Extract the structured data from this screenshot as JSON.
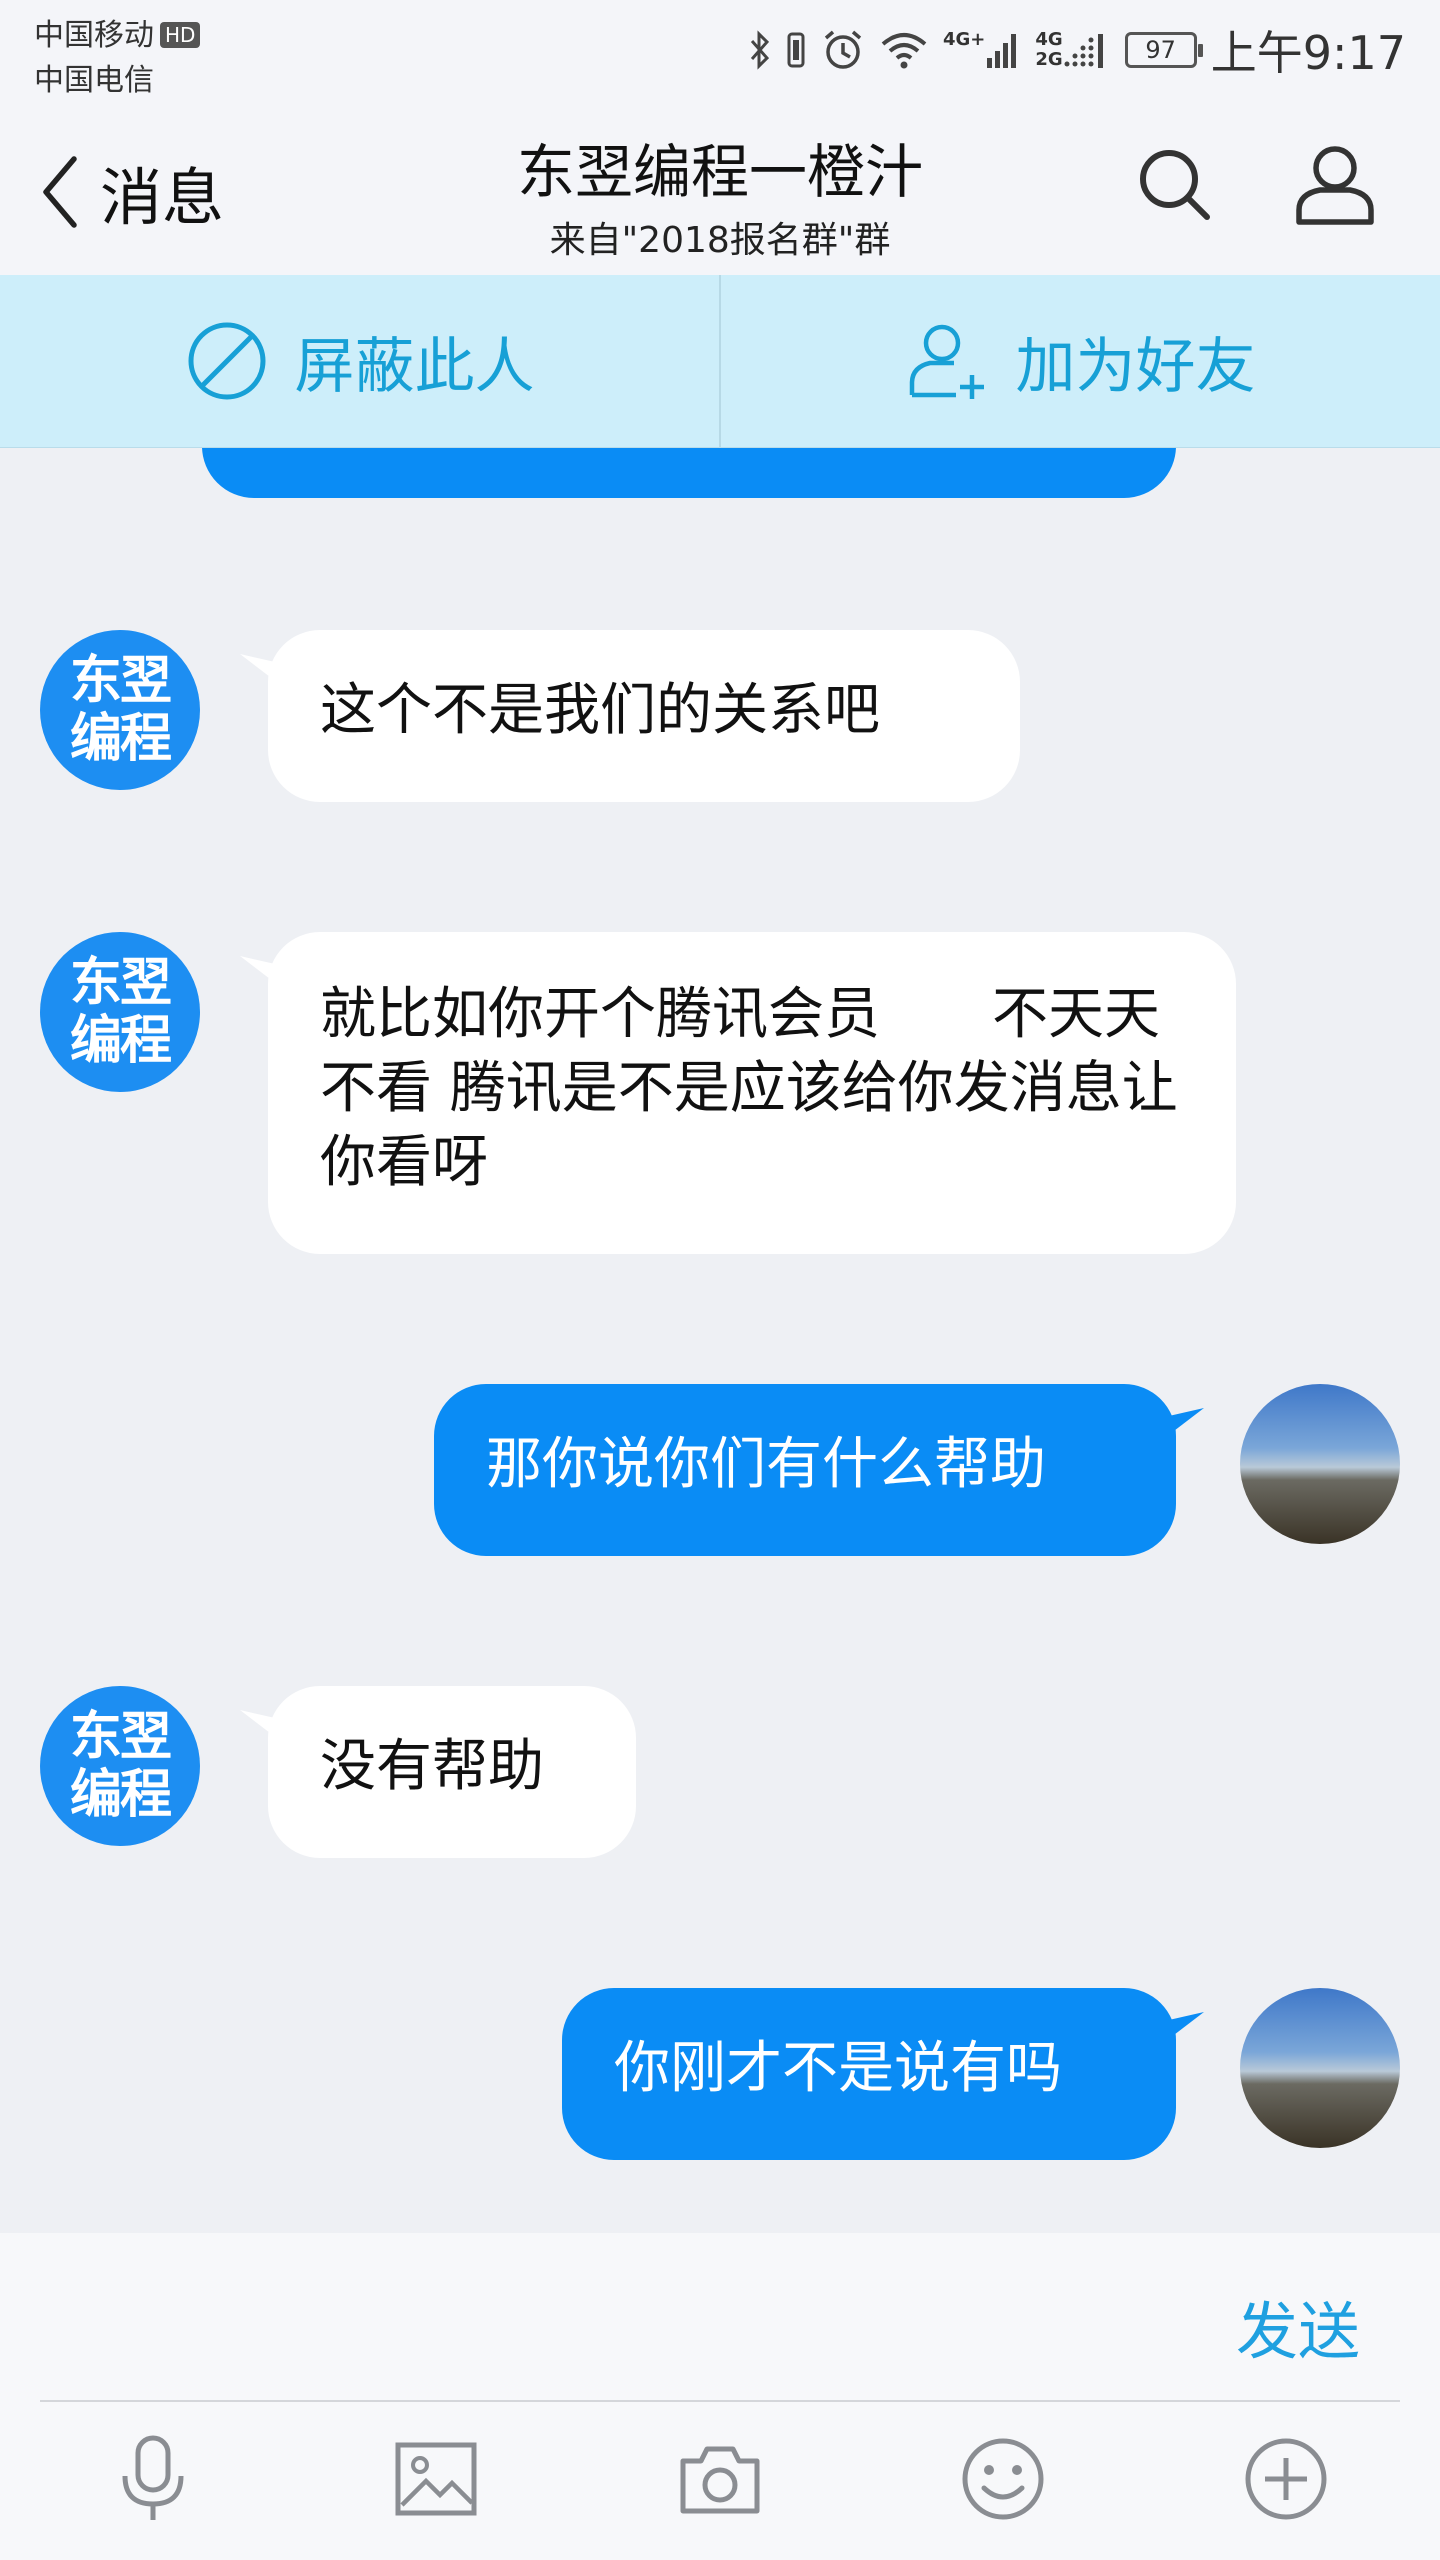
{
  "status_bar": {
    "carrier_1": "中国移动",
    "carrier_1_badge": "HD",
    "carrier_2": "中国电信",
    "network_1": "4G+",
    "network_2_top": "4G",
    "network_2_bottom": "2G",
    "battery": "97",
    "time": "上午9:17"
  },
  "header": {
    "back_label": "消息",
    "title": "东翌编程一橙汁",
    "subtitle": "来自\"2018报名群\"群"
  },
  "actions": {
    "block_label": "屏蔽此人",
    "add_friend_label": "加为好友"
  },
  "brand_avatar": {
    "line1": "东翌",
    "line2": "编程"
  },
  "messages": [
    {
      "side": "in",
      "text": "这个不是我们的关系吧"
    },
    {
      "side": "in",
      "text": "就比如你开个腾讯会员　　不天天不看 腾讯是不是应该给你发消息让你看呀"
    },
    {
      "side": "out",
      "text": "那你说你们有什么帮助"
    },
    {
      "side": "in",
      "text": "没有帮助"
    },
    {
      "side": "out",
      "text": "你刚才不是说有吗"
    }
  ],
  "input": {
    "value": "",
    "send_label": "发送"
  },
  "toolbar": [
    "microphone-icon",
    "image-icon",
    "camera-icon",
    "emoji-icon",
    "plus-icon"
  ],
  "colors": {
    "accent": "#0a8cf5",
    "action_text": "#17a0d6",
    "action_bg": "#cdeefa"
  }
}
